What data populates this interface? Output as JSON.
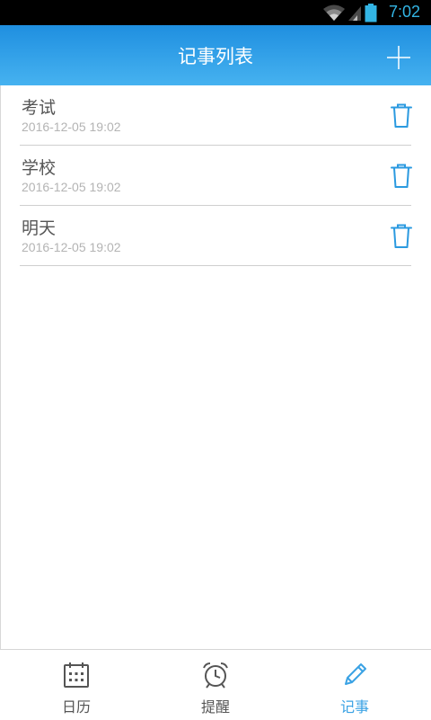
{
  "status_bar": {
    "time": "7:02",
    "icons": [
      "wifi-icon",
      "signal-icon",
      "battery-icon"
    ],
    "color": "#33b5e5"
  },
  "app_bar": {
    "title": "记事列表",
    "add_icon": "plus-icon",
    "gradient": [
      "#1f8fe0",
      "#46b2f0"
    ]
  },
  "notes": [
    {
      "title": "考试",
      "time": "2016-12-05 19:02",
      "action_icon": "trash-icon"
    },
    {
      "title": "学校",
      "time": "2016-12-05 19:02",
      "action_icon": "trash-icon"
    },
    {
      "title": "明天",
      "time": "2016-12-05 19:02",
      "action_icon": "trash-icon"
    }
  ],
  "bottom_nav": {
    "items": [
      {
        "label": "日历",
        "icon": "calendar-icon",
        "active": false
      },
      {
        "label": "提醒",
        "icon": "alarm-clock-icon",
        "active": false
      },
      {
        "label": "记事",
        "icon": "pencil-icon",
        "active": true
      }
    ],
    "active_color": "#3aa2e4",
    "inactive_color": "#555555"
  }
}
